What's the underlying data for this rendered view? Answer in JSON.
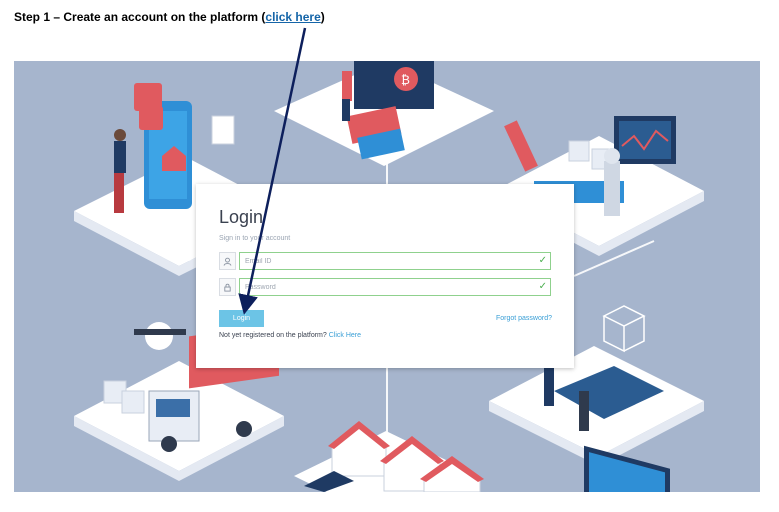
{
  "step": {
    "prefix": "Step 1 – Create an account on the platform (",
    "link": "click here",
    "suffix": ")"
  },
  "login": {
    "title": "Login",
    "subtitle": "Sign in to your account",
    "email_placeholder": "Email ID",
    "password_placeholder": "Password",
    "button_label": "Login",
    "forgot_label": "Forgot password?",
    "register_prompt": "Not yet registered on the platform?",
    "register_link": "Click Here"
  },
  "icons": {
    "email": "user-icon",
    "password": "lock-icon",
    "valid": "check-icon"
  },
  "colors": {
    "link": "#1565a8",
    "accent": "#6cc4e6",
    "valid": "#4caf50",
    "arrow": "#0d1f5c",
    "background": "#a6b5cd"
  }
}
